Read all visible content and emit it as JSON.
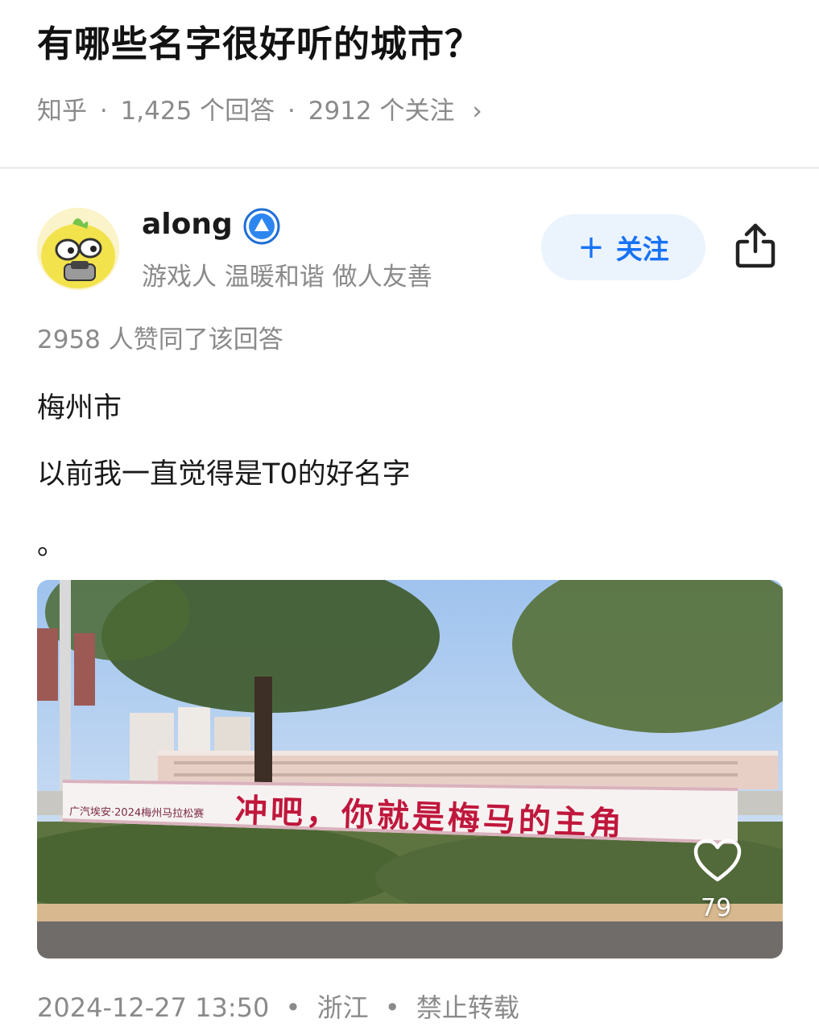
{
  "question": {
    "title": "有哪些名字很好听的城市？",
    "source": "知乎",
    "answers": "1,425 个回答",
    "followers": "2912 个关注",
    "separator": "·",
    "chevron": "›"
  },
  "author": {
    "name": "along",
    "bio": "游戏人 温暖和谐 做人友善",
    "badge_icon": "verified-triangle-badge-icon",
    "avatar_icon": "cartoon-avatar-icon"
  },
  "follow_button": {
    "plus": "+",
    "label": "关注"
  },
  "share_icon": "share-icon",
  "votes": "2958 人赞同了该回答",
  "answer": {
    "line1": "梅州市",
    "line2": "以前我一直觉得是T0的好名字",
    "line3": "。"
  },
  "photo": {
    "banner_small": "广汽埃安·2024梅州马拉松赛",
    "banner_main": "冲吧，你就是梅马的主角",
    "likes": "79",
    "like_icon": "heart-icon"
  },
  "footer": {
    "date": "2024-12-27 13:50",
    "location": "浙江",
    "rights": "禁止转载",
    "dot": "•"
  },
  "colors": {
    "accent": "#1772f6",
    "follow_bg": "#ebf3fd",
    "meta_gray": "#8a8a8a",
    "banner_red": "#c0173c"
  }
}
